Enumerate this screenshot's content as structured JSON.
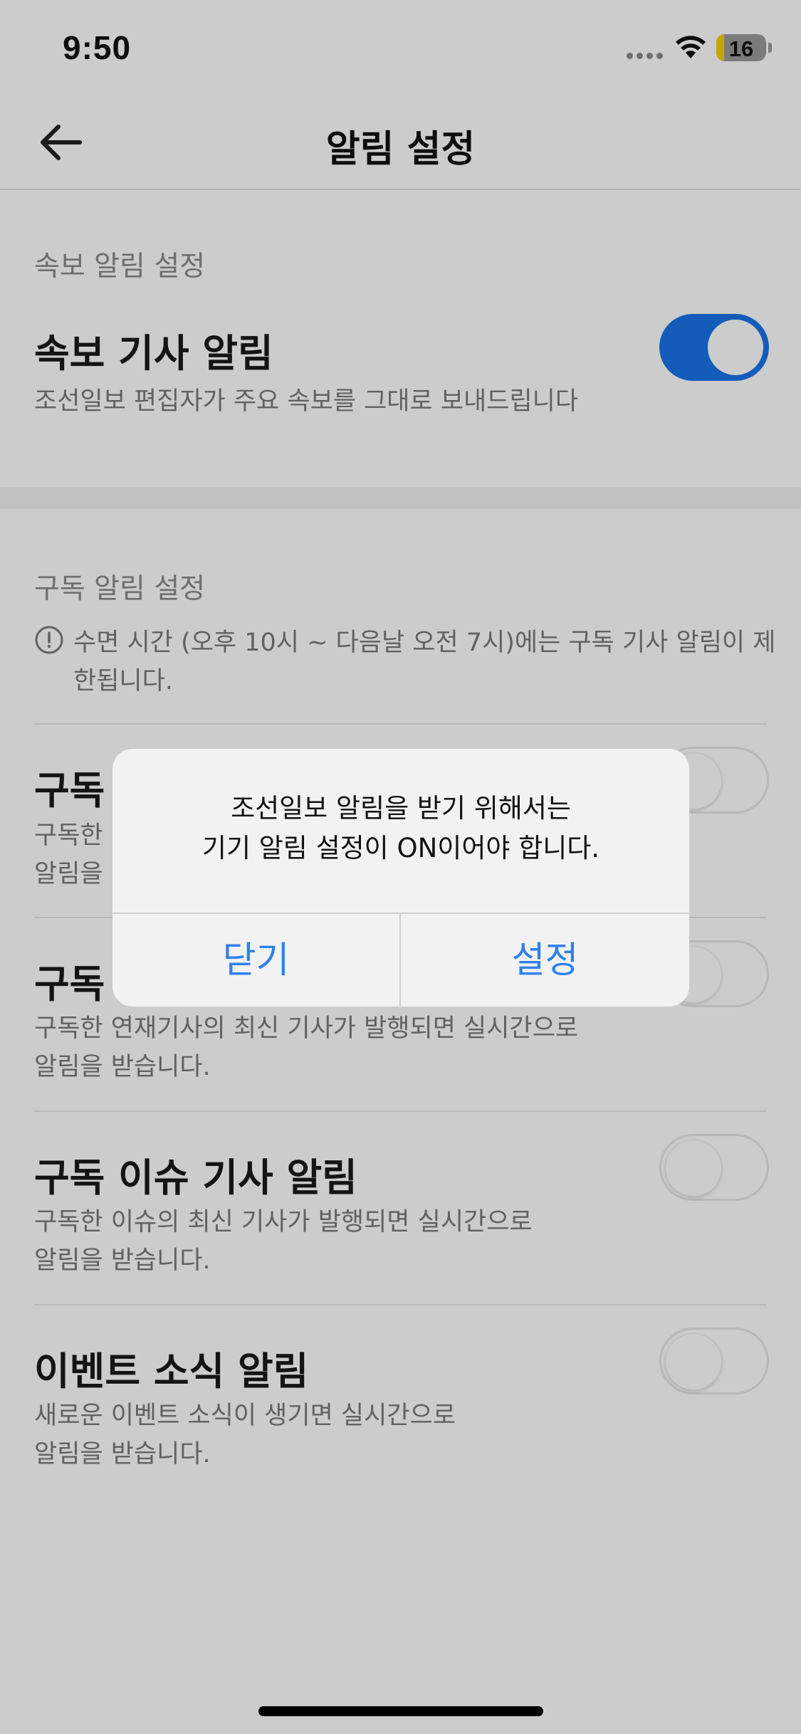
{
  "status_bar": {
    "time": "9:50",
    "battery_level": "16",
    "battery_percent": 16,
    "icons": [
      "cellular-signal-icon",
      "wifi-icon",
      "battery-icon"
    ]
  },
  "nav": {
    "title": "알림 설정",
    "back_icon": "back-arrow-icon"
  },
  "breaking_section": {
    "title": "속보 알림 설정",
    "row": {
      "title": "속보 기사 알림",
      "description": "조선일보 편집자가 주요 속보를 그대로 보내드립니다",
      "enabled": true
    }
  },
  "subscription_section": {
    "title": "구독 알림 설정",
    "notice": "수면 시간 (오후 10시 ~ 다음날 오전 7시)에는 구독 기사 알림이 제한됩니다.",
    "notice_icon": "info-circle-icon",
    "rows": [
      {
        "title": "구독",
        "description": "구독한 …",
        "description_line2": "알림을 …",
        "enabled": false
      },
      {
        "title": "구독",
        "description": "구독한 연재기사의 최신 기사가 발행되면 실시간으로",
        "description_line2": "알림을 받습니다.",
        "enabled": false
      },
      {
        "title": "구독 이슈 기사 알림",
        "description": "구독한 이슈의 최신 기사가 발행되면 실시간으로",
        "description_line2": "알림을 받습니다.",
        "enabled": false
      },
      {
        "title": "이벤트 소식 알림",
        "description": "새로운 이벤트 소식이 생기면 실시간으로",
        "description_line2": "알림을 받습니다.",
        "enabled": false
      }
    ]
  },
  "dialog": {
    "message_line1": "조선일보 알림을 받기 위해서는",
    "message_line2": "기기 알림 설정이 ON이어야 합니다.",
    "close_label": "닫기",
    "settings_label": "설정"
  },
  "colors": {
    "accent": "#1a74e8",
    "dialog_button": "#2f80ec",
    "dim_overlay": "rgba(0,0,0,0.2)"
  }
}
